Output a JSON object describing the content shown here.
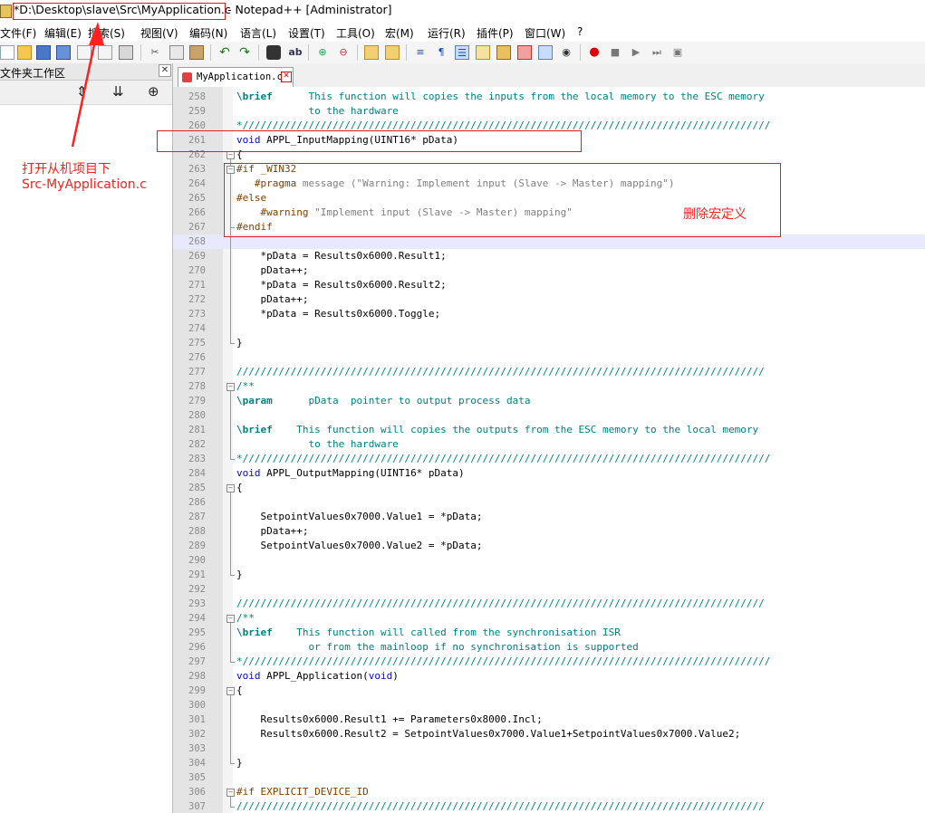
{
  "window": {
    "title_path": "*D:\\Desktop\\slave\\Src\\MyApplication.c",
    "title_tail": "- Notepad++ [Administrator]"
  },
  "menu": [
    "文件(F)",
    "编辑(E)",
    "搜索(S)",
    "视图(V)",
    "编码(N)",
    "语言(L)",
    "设置(T)",
    "工具(O)",
    "宏(M)",
    "运行(R)",
    "插件(P)",
    "窗口(W)",
    "?"
  ],
  "side_panel": {
    "title": "文件夹工作区",
    "close": "✕"
  },
  "tab": {
    "name": "MyApplication.c"
  },
  "annotations": {
    "open_note_line1": "打开从机项目下",
    "open_note_line2": "Src-MyApplication.c",
    "delete_macro": "删除宏定义"
  },
  "code": [
    {
      "n": "258",
      "t": "\\brief      This function will copies the inputs from the local memory to the ESC memory"
    },
    {
      "n": "259",
      "t": "            to the hardware"
    },
    {
      "n": "260",
      "t": "*////////////////////////////////////////////////////////////////////////////////////////"
    },
    {
      "n": "261",
      "t": "void APPL_InputMapping(UINT16* pData)"
    },
    {
      "n": "262",
      "t": "{"
    },
    {
      "n": "263",
      "t": "#if _WIN32"
    },
    {
      "n": "264",
      "t": "   #pragma message (\"Warning: Implement input (Slave -> Master) mapping\")"
    },
    {
      "n": "265",
      "t": "#else"
    },
    {
      "n": "266",
      "t": "    #warning \"Implement input (Slave -> Master) mapping\""
    },
    {
      "n": "267",
      "t": "#endif"
    },
    {
      "n": "268",
      "t": ""
    },
    {
      "n": "269",
      "t": "    *pData = Results0x6000.Result1;"
    },
    {
      "n": "270",
      "t": "    pData++;"
    },
    {
      "n": "271",
      "t": "    *pData = Results0x6000.Result2;"
    },
    {
      "n": "272",
      "t": "    pData++;"
    },
    {
      "n": "273",
      "t": "    *pData = Results0x6000.Toggle;"
    },
    {
      "n": "274",
      "t": ""
    },
    {
      "n": "275",
      "t": "}"
    },
    {
      "n": "276",
      "t": ""
    },
    {
      "n": "277",
      "t": "////////////////////////////////////////////////////////////////////////////////////////"
    },
    {
      "n": "278",
      "t": "/**"
    },
    {
      "n": "279",
      "t": "\\param      pData  pointer to output process data"
    },
    {
      "n": "280",
      "t": ""
    },
    {
      "n": "281",
      "t": "\\brief    This function will copies the outputs from the ESC memory to the local memory"
    },
    {
      "n": "282",
      "t": "            to the hardware"
    },
    {
      "n": "283",
      "t": "*////////////////////////////////////////////////////////////////////////////////////////"
    },
    {
      "n": "284",
      "t": "void APPL_OutputMapping(UINT16* pData)"
    },
    {
      "n": "285",
      "t": "{"
    },
    {
      "n": "286",
      "t": ""
    },
    {
      "n": "287",
      "t": "    SetpointValues0x7000.Value1 = *pData;"
    },
    {
      "n": "288",
      "t": "    pData++;"
    },
    {
      "n": "289",
      "t": "    SetpointValues0x7000.Value2 = *pData;"
    },
    {
      "n": "290",
      "t": ""
    },
    {
      "n": "291",
      "t": "}"
    },
    {
      "n": "292",
      "t": ""
    },
    {
      "n": "293",
      "t": "////////////////////////////////////////////////////////////////////////////////////////"
    },
    {
      "n": "294",
      "t": "/**"
    },
    {
      "n": "295",
      "t": "\\brief    This function will called from the synchronisation ISR"
    },
    {
      "n": "296",
      "t": "            or from the mainloop if no synchronisation is supported"
    },
    {
      "n": "297",
      "t": "*////////////////////////////////////////////////////////////////////////////////////////"
    },
    {
      "n": "298",
      "t": "void APPL_Application(void)"
    },
    {
      "n": "299",
      "t": "{"
    },
    {
      "n": "300",
      "t": ""
    },
    {
      "n": "301",
      "t": "    Results0x6000.Result1 += Parameters0x8000.Incl;"
    },
    {
      "n": "302",
      "t": "    Results0x6000.Result2 = SetpointValues0x7000.Value1+SetpointValues0x7000.Value2;"
    },
    {
      "n": "303",
      "t": ""
    },
    {
      "n": "304",
      "t": "}"
    },
    {
      "n": "305",
      "t": ""
    },
    {
      "n": "306",
      "t": "#if EXPLICIT_DEVICE_ID"
    },
    {
      "n": "307",
      "t": "////////////////////////////////////////////////////////////////////////////////////////"
    }
  ]
}
